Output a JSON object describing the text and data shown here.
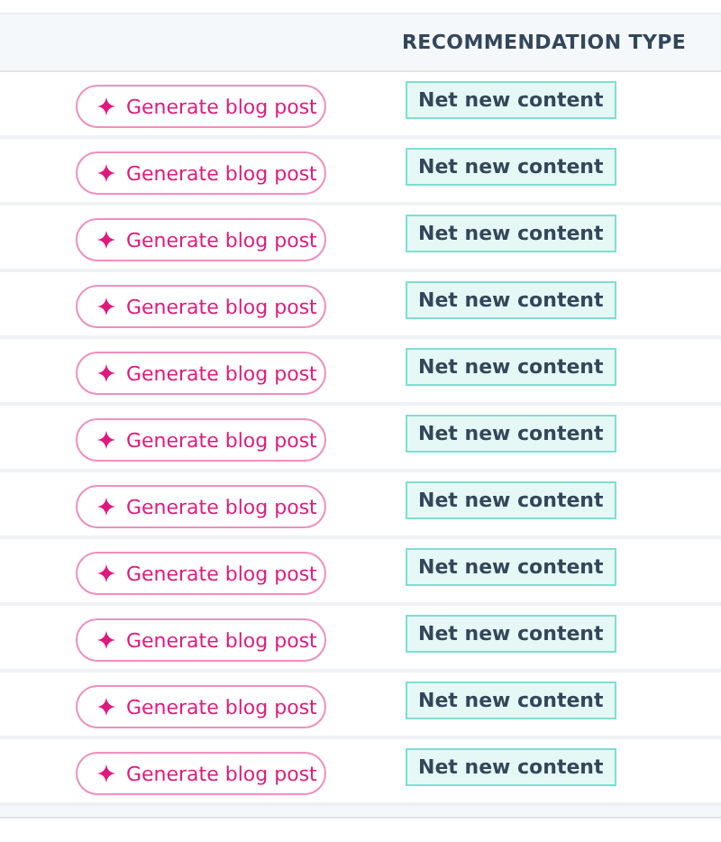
{
  "table": {
    "columns": [
      {
        "label": "RECOMMENDATION TYPE"
      }
    ],
    "rows": [
      {
        "action": "Generate blog post",
        "type": "Net new content"
      },
      {
        "action": "Generate blog post",
        "type": "Net new content"
      },
      {
        "action": "Generate blog post",
        "type": "Net new content"
      },
      {
        "action": "Generate blog post",
        "type": "Net new content"
      },
      {
        "action": "Generate blog post",
        "type": "Net new content"
      },
      {
        "action": "Generate blog post",
        "type": "Net new content"
      },
      {
        "action": "Generate blog post",
        "type": "Net new content"
      },
      {
        "action": "Generate blog post",
        "type": "Net new content"
      },
      {
        "action": "Generate blog post",
        "type": "Net new content"
      },
      {
        "action": "Generate blog post",
        "type": "Net new content"
      },
      {
        "action": "Generate blog post",
        "type": "Net new content"
      }
    ]
  }
}
